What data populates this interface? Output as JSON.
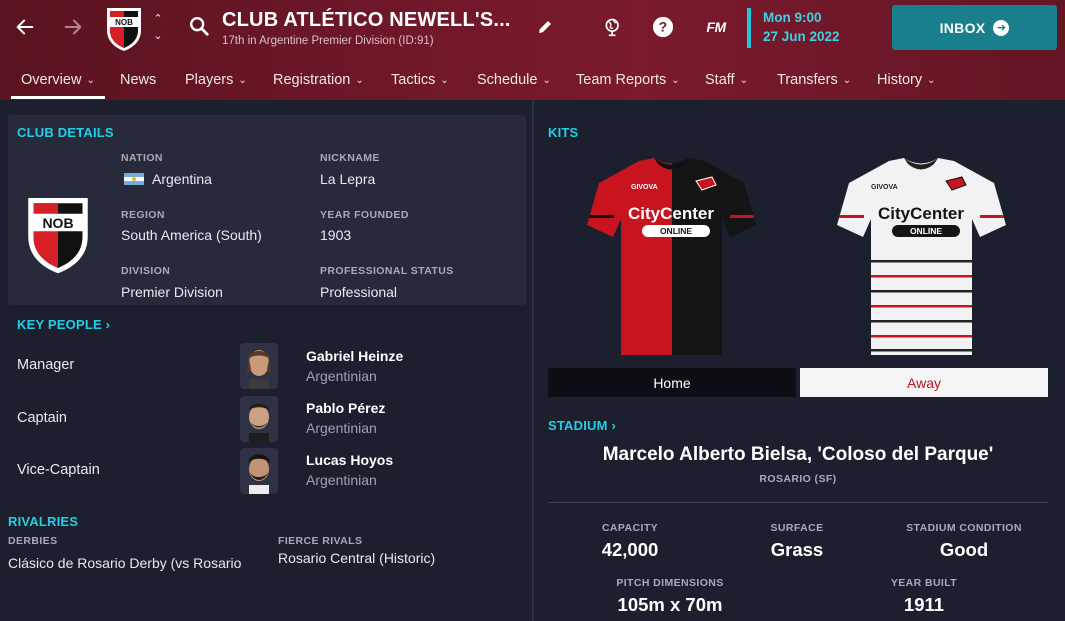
{
  "header": {
    "club_name": "CLUB ATLÉTICO NEWELL'S...",
    "club_subtitle": "17th in Argentine Premier Division (ID:91)",
    "badge_text": "NOB",
    "fm_label": "FM",
    "date_day": "Mon 9:00",
    "date_date": "27 Jun 2022",
    "inbox_label": "INBOX"
  },
  "tabs": [
    {
      "label": "Overview"
    },
    {
      "label": "News"
    },
    {
      "label": "Players"
    },
    {
      "label": "Registration"
    },
    {
      "label": "Tactics"
    },
    {
      "label": "Schedule"
    },
    {
      "label": "Team Reports"
    },
    {
      "label": "Staff"
    },
    {
      "label": "Transfers"
    },
    {
      "label": "History"
    }
  ],
  "club_details": {
    "title": "CLUB DETAILS",
    "badge_text": "NOB",
    "nation_label": "NATION",
    "nation": "Argentina",
    "nickname_label": "NICKNAME",
    "nickname": "La Lepra",
    "region_label": "REGION",
    "region": "South America (South)",
    "year_founded_label": "YEAR FOUNDED",
    "year_founded": "1903",
    "division_label": "DIVISION",
    "division": "Premier Division",
    "pro_status_label": "PROFESSIONAL STATUS",
    "pro_status": "Professional"
  },
  "key_people": {
    "title": "KEY PEOPLE",
    "people": [
      {
        "role": "Manager",
        "name": "Gabriel Heinze",
        "nationality": "Argentinian"
      },
      {
        "role": "Captain",
        "name": "Pablo Pérez",
        "nationality": "Argentinian"
      },
      {
        "role": "Vice-Captain",
        "name": "Lucas Hoyos",
        "nationality": "Argentinian"
      }
    ]
  },
  "rivalries": {
    "title": "RIVALRIES",
    "derbies_label": "DERBIES",
    "derbies": "Clásico de Rosario Derby (vs Rosario",
    "fierce_label": "FIERCE RIVALS",
    "fierce": "Rosario Central (Historic)"
  },
  "kits": {
    "title": "KITS",
    "sponsor": "CityCenter",
    "sponsor_sub": "ONLINE",
    "maker": "GIVOVA",
    "home_label": "Home",
    "away_label": "Away"
  },
  "stadium": {
    "title": "STADIUM",
    "name": "Marcelo Alberto Bielsa, 'Coloso del Parque'",
    "city": "ROSARIO (SF)",
    "capacity_label": "CAPACITY",
    "capacity": "42,000",
    "surface_label": "SURFACE",
    "surface": "Grass",
    "condition_label": "STADIUM CONDITION",
    "condition": "Good",
    "pitch_label": "PITCH DIMENSIONS",
    "pitch": "105m x 70m",
    "year_built_label": "YEAR BUILT",
    "year_built": "1911"
  },
  "colors": {
    "accent_cyan": "#22cfe6",
    "header_red": "#6e1728",
    "inbox_teal": "#1a7f8c",
    "panel_bg": "#262a3b",
    "page_bg": "#1c1f2e"
  }
}
